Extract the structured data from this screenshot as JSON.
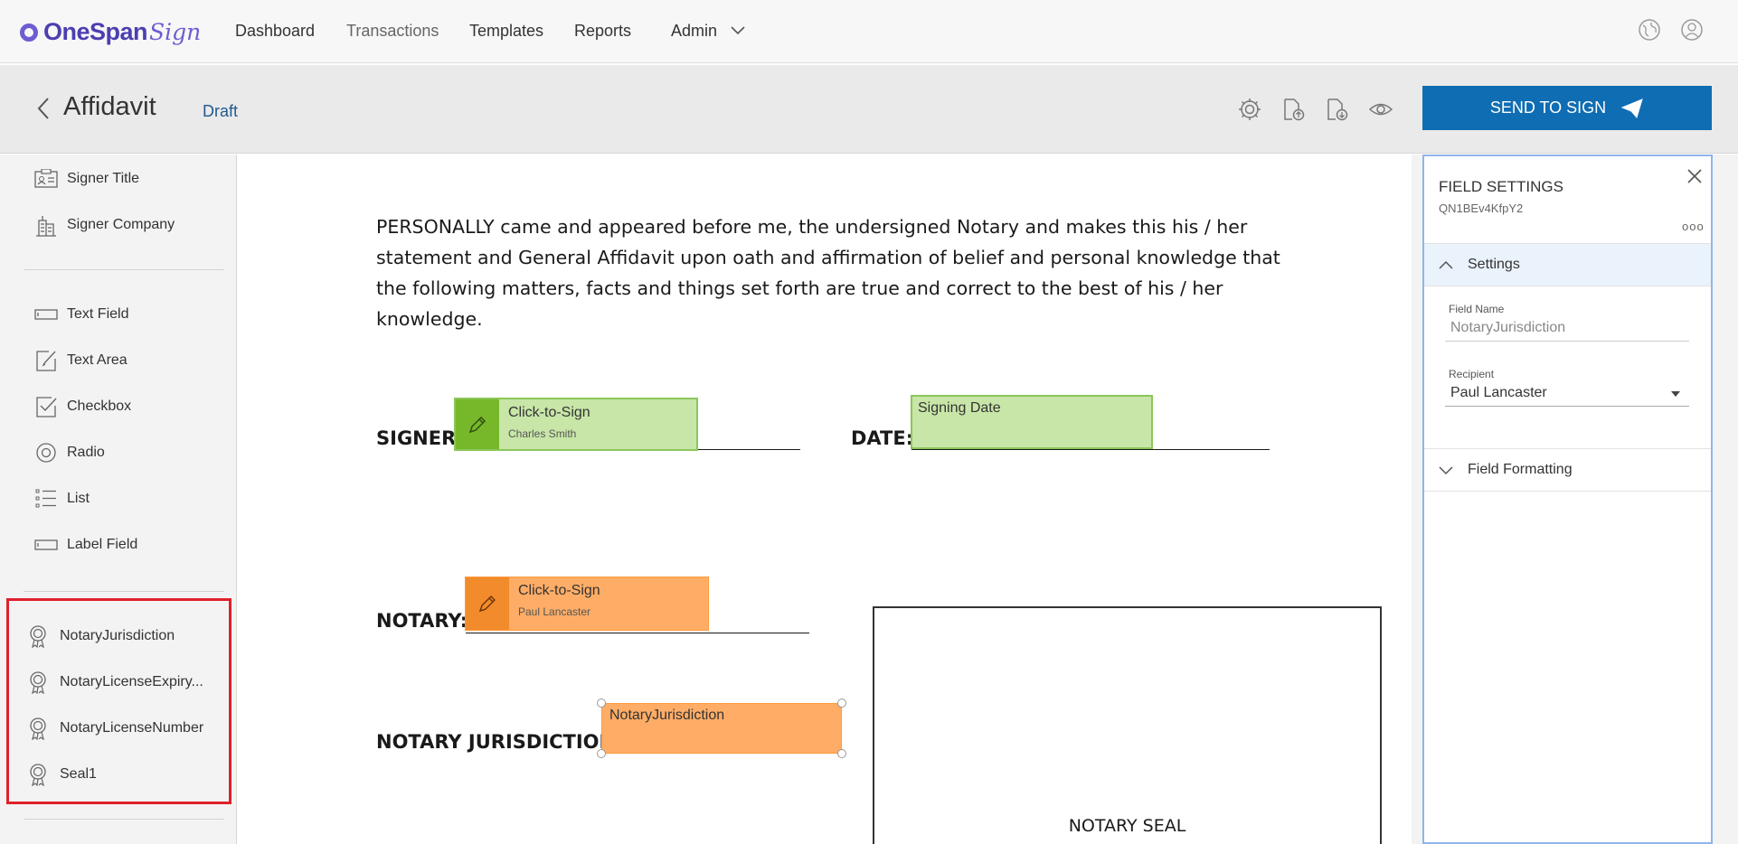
{
  "app": {
    "logo_text": "OneSpan",
    "logo_script": "Sign",
    "brand_color": "#4b3fb1"
  },
  "nav": {
    "items": [
      {
        "label": "Dashboard"
      },
      {
        "label": "Transactions"
      },
      {
        "label": "Templates"
      },
      {
        "label": "Reports"
      },
      {
        "label": "Admin"
      }
    ],
    "icons": [
      "globe-icon",
      "user-icon"
    ]
  },
  "header": {
    "title": "Affidavit",
    "status": "Draft",
    "toolbar_icons": [
      "gear-icon",
      "upload-document-icon",
      "download-document-icon",
      "eye-icon"
    ],
    "send_label": "SEND TO SIGN",
    "send_color": "#0f6db3"
  },
  "sidebar": {
    "top_items": [
      {
        "label": "Signer Title",
        "icon": "id-card-icon"
      },
      {
        "label": "Signer Company",
        "icon": "building-icon"
      }
    ],
    "field_items": [
      {
        "label": "Text Field",
        "icon": "text-field-icon"
      },
      {
        "label": "Text Area",
        "icon": "text-area-icon"
      },
      {
        "label": "Checkbox",
        "icon": "checkbox-icon"
      },
      {
        "label": "Radio",
        "icon": "radio-icon"
      },
      {
        "label": "List",
        "icon": "list-icon"
      },
      {
        "label": "Label Field",
        "icon": "label-field-icon"
      }
    ],
    "notary_items": [
      {
        "label": "NotaryJurisdiction",
        "icon": "seal-icon"
      },
      {
        "label": "NotaryLicenseExpiry...",
        "icon": "seal-icon"
      },
      {
        "label": "NotaryLicenseNumber",
        "icon": "seal-icon"
      },
      {
        "label": "Seal1",
        "icon": "seal-icon"
      }
    ],
    "highlight_color": "#e0202a"
  },
  "document": {
    "paragraph": "PERSONALLY came and appeared before me, the undersigned Notary and makes this his / her statement and General Affidavit upon oath and affirmation of belief and personal knowledge that the following matters, facts and things set forth are true and correct to the best of his / her knowledge.",
    "signer_label": "SIGNER:",
    "date_label": "DATE:",
    "notary_label": "NOTARY:",
    "jurisdiction_label": "NOTARY JURISDICTION:",
    "seal_label": "NOTARY SEAL",
    "signer_field": {
      "title": "Click-to-Sign",
      "name": "Charles Smith",
      "color": "#c8e6a8"
    },
    "date_field": {
      "title": "Signing Date"
    },
    "notary_field": {
      "title": "Click-to-Sign",
      "name": "Paul Lancaster",
      "color": "#ffad66"
    },
    "jurisdiction_field": {
      "title": "NotaryJurisdiction"
    }
  },
  "panel": {
    "title": "FIELD SETTINGS",
    "id": "QN1BEv4KfpY2",
    "more": "ooo",
    "settings_section": "Settings",
    "field_name_label": "Field Name",
    "field_name_value": "NotaryJurisdiction",
    "recipient_label": "Recipient",
    "recipient_value": "Paul Lancaster",
    "formatting_section": "Field Formatting"
  }
}
